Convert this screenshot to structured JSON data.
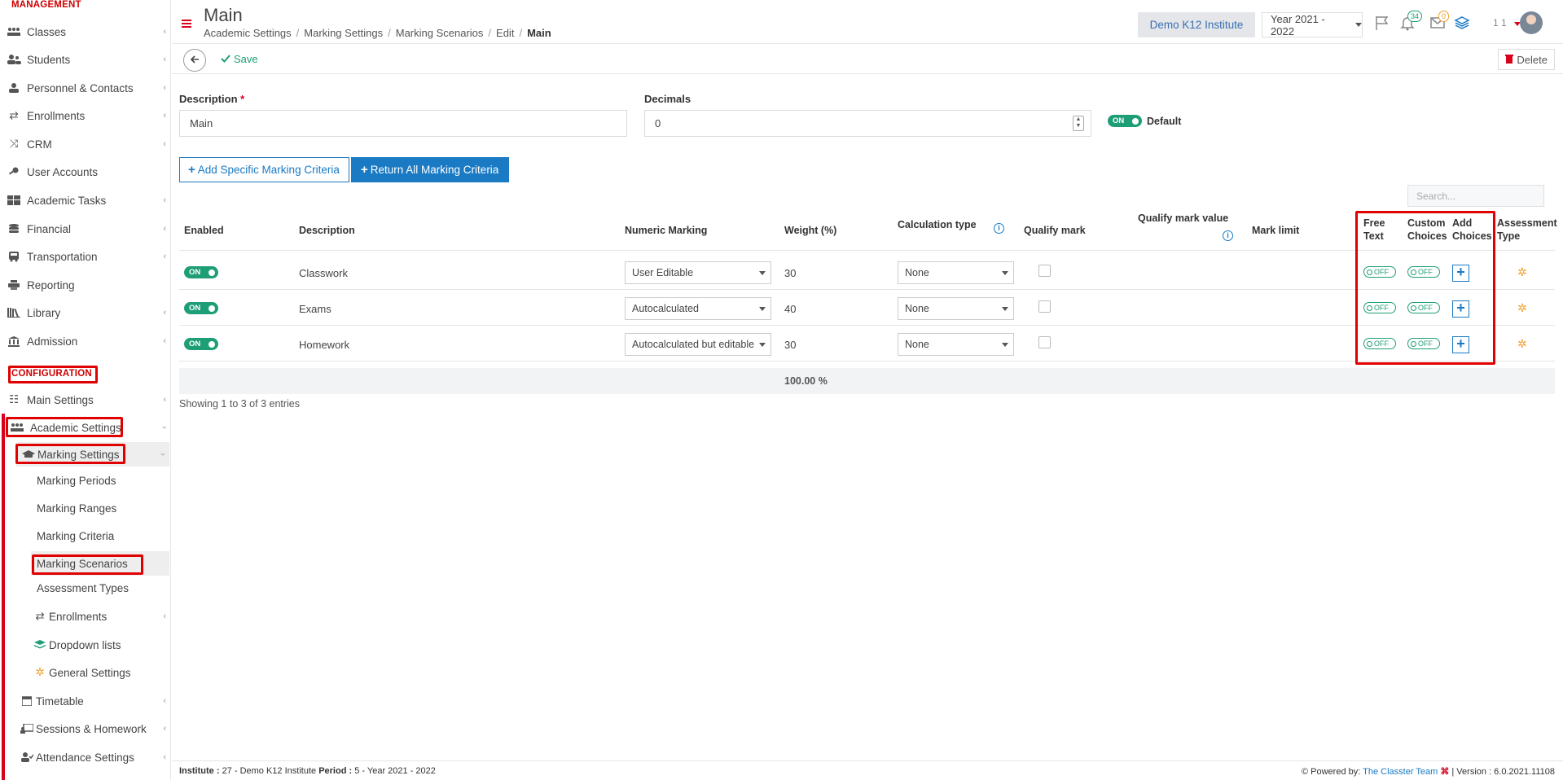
{
  "sidebar": {
    "management_label": "MANAGEMENT",
    "items": [
      {
        "label": "Classes"
      },
      {
        "label": "Students"
      },
      {
        "label": "Personnel & Contacts"
      },
      {
        "label": "Enrollments"
      },
      {
        "label": "CRM"
      },
      {
        "label": "User Accounts"
      },
      {
        "label": "Academic Tasks"
      },
      {
        "label": "Financial"
      },
      {
        "label": "Transportation"
      },
      {
        "label": "Reporting"
      },
      {
        "label": "Library"
      },
      {
        "label": "Admission"
      }
    ],
    "configuration_label": "CONFIGURATION",
    "config_items": [
      {
        "label": "Main Settings"
      },
      {
        "label": "Academic Settings"
      },
      {
        "label": "Marking Settings"
      },
      {
        "label": "Marking Periods"
      },
      {
        "label": "Marking Ranges"
      },
      {
        "label": "Marking Criteria"
      },
      {
        "label": "Marking Scenarios"
      },
      {
        "label": "Assessment Types"
      },
      {
        "label": "Enrollments"
      },
      {
        "label": "Dropdown lists"
      },
      {
        "label": "General Settings"
      },
      {
        "label": "Timetable"
      },
      {
        "label": "Sessions & Homework"
      },
      {
        "label": "Attendance Settings"
      }
    ]
  },
  "header": {
    "title": "Main",
    "breadcrumb": [
      "Academic Settings",
      "Marking Settings",
      "Marking Scenarios",
      "Edit",
      "Main"
    ],
    "institute": "Demo K12 Institute",
    "year": "Year 2021 - 2022",
    "notif_count": "34",
    "mail_count": "0",
    "user_short": "1 1"
  },
  "toolbar": {
    "save_label": "Save",
    "delete_label": "Delete"
  },
  "form": {
    "description_label": "Description",
    "description_value": "Main",
    "decimals_label": "Decimals",
    "decimals_value": "0",
    "default_toggle": "ON",
    "default_label": "Default"
  },
  "actions": {
    "add_specific": "Add Specific Marking Criteria",
    "return_all": "Return All Marking Criteria",
    "search_placeholder": "Search..."
  },
  "table": {
    "headers": {
      "enabled": "Enabled",
      "description": "Description",
      "numeric_marking": "Numeric Marking",
      "weight": "Weight (%)",
      "calc_type": "Calculation type",
      "qualify_mark": "Qualify mark",
      "qualify_mark_value": "Qualify mark value",
      "mark_limit": "Mark limit",
      "free_text_1": "Free",
      "free_text_2": "Text",
      "custom_choices_1": "Custom",
      "custom_choices_2": "Choices",
      "add_choices_1": "Add",
      "add_choices_2": "Choices",
      "assessment_type_1": "Assessment",
      "assessment_type_2": "Type"
    },
    "rows": [
      {
        "enabled": "ON",
        "description": "Classwork",
        "numeric_marking": "User Editable",
        "weight": "30",
        "calc_type": "None",
        "free_text": "OFF",
        "custom_choices": "OFF"
      },
      {
        "enabled": "ON",
        "description": "Exams",
        "numeric_marking": "Autocalculated",
        "weight": "40",
        "calc_type": "None",
        "free_text": "OFF",
        "custom_choices": "OFF"
      },
      {
        "enabled": "ON",
        "description": "Homework",
        "numeric_marking": "Autocalculated but editable",
        "weight": "30",
        "calc_type": "None",
        "free_text": "OFF",
        "custom_choices": "OFF"
      }
    ],
    "total_weight": "100.00 %",
    "showing": "Showing 1 to 3 of 3 entries"
  },
  "footer": {
    "institute_label": "Institute :",
    "institute_value": "27 - Demo K12 Institute",
    "period_label": "Period :",
    "period_value": "5 - Year 2021 - 2022",
    "powered_by": "Powered by:",
    "team": "The Classter Team",
    "version": "| Version : 6.0.2021.11108"
  }
}
